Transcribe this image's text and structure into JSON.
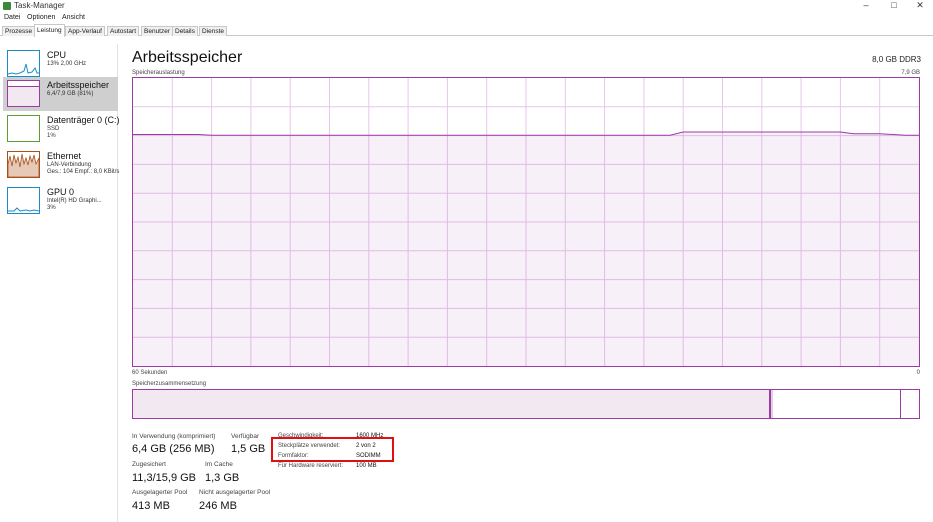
{
  "window": {
    "title": "Task-Manager",
    "minimize": "–",
    "maximize": "□",
    "close": "✕"
  },
  "menu": [
    "Datei",
    "Optionen",
    "Ansicht"
  ],
  "tabs": [
    {
      "label": "Prozesse",
      "active": false
    },
    {
      "label": "Leistung",
      "active": true
    },
    {
      "label": "App-Verlauf",
      "active": false
    },
    {
      "label": "Autostart",
      "active": false
    },
    {
      "label": "Benutzer",
      "active": false
    },
    {
      "label": "Details",
      "active": false
    },
    {
      "label": "Dienste",
      "active": false
    }
  ],
  "sidebar": {
    "items": [
      {
        "name": "CPU",
        "sub": [
          "13% 2,00 GHz"
        ],
        "color": "#1c8cc8"
      },
      {
        "name": "Arbeitsspeicher",
        "sub": [
          "6,4/7,9 GB (81%)"
        ],
        "color": "#9c3ba6",
        "fill": 0.81
      },
      {
        "name": "Datenträger 0 (C:)",
        "sub": [
          "SSD",
          "1%"
        ],
        "color": "#5aa02c"
      },
      {
        "name": "Ethernet",
        "sub": [
          "LAN-Verbindung",
          "Ges.: 104  Empf.: 8,0 KBit/s"
        ],
        "color": "#a6501c"
      },
      {
        "name": "GPU 0",
        "sub": [
          "Intel(R) HD Graphi...",
          "3%"
        ],
        "color": "#1c8cc8"
      }
    ]
  },
  "main": {
    "title": "Arbeitsspeicher",
    "spec": "8,0 GB DDR3",
    "usage_label": "Speicherauslastung",
    "usage_max": "7,9 GB",
    "time_left": "60 Sekunden",
    "time_right": "0",
    "composition_label": "Speicherzusammensetzung"
  },
  "composition": {
    "in_use_fraction": 0.81,
    "modified_fraction": 0.004,
    "standby_end_fraction": 0.976
  },
  "stats": {
    "in_use_label": "In Verwendung (komprimiert)",
    "in_use_value": "6,4 GB (256 MB)",
    "available_label": "Verfügbar",
    "available_value": "1,5 GB",
    "committed_label": "Zugesichert",
    "committed_value": "11,3/15,9 GB",
    "cached_label": "Im Cache",
    "cached_value": "1,3 GB",
    "paged_label": "Ausgelagerter Pool",
    "paged_value": "413 MB",
    "nonpaged_label": "Nicht ausgelagerter Pool",
    "nonpaged_value": "246 MB"
  },
  "info": {
    "speed_label": "Geschwindigkeit:",
    "speed_value": "1600 MHz",
    "slots_label": "Steckplätze verwendet:",
    "slots_value": "2 von 2",
    "form_label": "Formfaktor:",
    "form_value": "SODIMM",
    "reserved_label": "Für Hardware reserviert:",
    "reserved_value": "100 MB"
  },
  "chart_data": {
    "type": "area",
    "title": "Speicherauslastung",
    "y_max_label": "7,9 GB",
    "xlabel_left": "60 Sekunden",
    "xlabel_right": "0",
    "ylim": [
      0,
      7.9
    ],
    "series": [
      {
        "values": [
          6.35,
          6.35,
          6.35,
          6.35,
          6.35,
          6.35,
          6.33,
          6.33,
          6.33,
          6.33,
          6.33,
          6.33,
          6.33,
          6.33,
          6.33,
          6.33,
          6.33,
          6.33,
          6.33,
          6.33,
          6.33,
          6.33,
          6.33,
          6.33,
          6.33,
          6.33,
          6.33,
          6.33,
          6.33,
          6.33,
          6.33,
          6.33,
          6.33,
          6.33,
          6.33,
          6.33,
          6.33,
          6.33,
          6.33,
          6.33,
          6.33,
          6.33,
          6.42,
          6.42,
          6.42,
          6.42,
          6.42,
          6.42,
          6.42,
          6.42,
          6.42,
          6.42,
          6.42,
          6.42,
          6.42,
          6.37,
          6.37,
          6.37,
          6.35,
          6.33,
          6.33
        ]
      }
    ],
    "grid": true,
    "color": "#9c3ba6"
  }
}
